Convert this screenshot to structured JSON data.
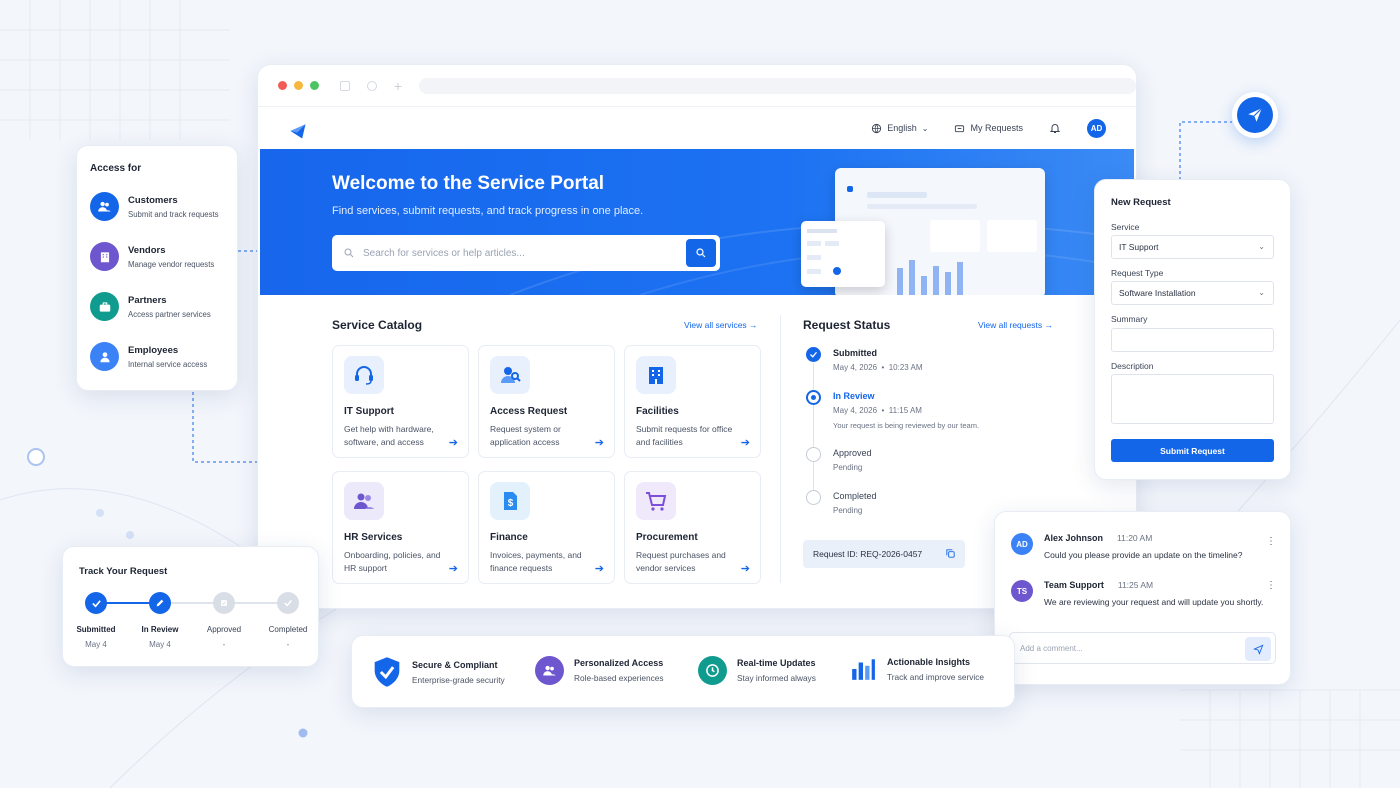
{
  "header": {
    "language": "English",
    "my_requests": "My Requests",
    "avatar_initials": "AD"
  },
  "hero": {
    "title": "Welcome to the Service Portal",
    "subtitle": "Find services, submit requests, and track progress in one place.",
    "search_placeholder": "Search for services or help articles..."
  },
  "catalog": {
    "title": "Service Catalog",
    "view_all": "View all services",
    "items": [
      {
        "title": "IT Support",
        "desc": "Get help with hardware, software, and access",
        "icon": "headset-icon"
      },
      {
        "title": "Access Request",
        "desc": "Request system or application access",
        "icon": "user-key-icon"
      },
      {
        "title": "Facilities",
        "desc": "Submit requests for office and facilities",
        "icon": "building-icon"
      },
      {
        "title": "HR Services",
        "desc": "Onboarding, policies, and HR support",
        "icon": "people-icon"
      },
      {
        "title": "Finance",
        "desc": "Invoices, payments, and finance requests",
        "icon": "dollar-doc-icon"
      },
      {
        "title": "Procurement",
        "desc": "Request purchases and vendor services",
        "icon": "cart-icon"
      }
    ]
  },
  "status": {
    "title": "Request Status",
    "view_all": "View all requests",
    "steps": [
      {
        "label": "Submitted",
        "date": "May 4, 2026",
        "time": "10:23 AM",
        "state": "done"
      },
      {
        "label": "In Review",
        "date": "May 4, 2026",
        "time": "11:15 AM",
        "note": "Your request is being reviewed by our team.",
        "state": "active"
      },
      {
        "label": "Approved",
        "sub": "Pending",
        "state": "pending"
      },
      {
        "label": "Completed",
        "sub": "Pending",
        "state": "pending"
      }
    ],
    "request_id": "Request ID: REQ-2026-0457"
  },
  "access": {
    "heading": "Access for",
    "items": [
      {
        "title": "Customers",
        "sub": "Submit and track requests",
        "color": "#1466e8"
      },
      {
        "title": "Vendors",
        "sub": "Manage vendor requests",
        "color": "#6e56cf"
      },
      {
        "title": "Partners",
        "sub": "Access partner services",
        "color": "#0f9b8e"
      },
      {
        "title": "Employees",
        "sub": "Internal service access",
        "color": "#3b82f6"
      }
    ]
  },
  "track": {
    "title": "Track Your Request",
    "steps": [
      {
        "label": "Submitted",
        "date": "May 4"
      },
      {
        "label": "In Review",
        "date": "May 4"
      },
      {
        "label": "Approved",
        "date": "-"
      },
      {
        "label": "Completed",
        "date": "-"
      }
    ]
  },
  "new_request": {
    "title": "New Request",
    "service_label": "Service",
    "service_value": "IT Support",
    "type_label": "Request Type",
    "type_value": "Software Installation",
    "summary_label": "Summary",
    "description_label": "Description",
    "submit": "Submit Request"
  },
  "chat": {
    "messages": [
      {
        "initials": "AD",
        "name": "Alex Johnson",
        "time": "11:20 AM",
        "text": "Could you please provide an update on the timeline?",
        "color": "#3b82f6"
      },
      {
        "initials": "TS",
        "name": "Team Support",
        "time": "11:25 AM",
        "text": "We are reviewing your request and will update you shortly.",
        "color": "#6e56cf"
      }
    ],
    "placeholder": "Add a comment..."
  },
  "features": [
    {
      "title": "Secure & Compliant",
      "sub": "Enterprise-grade security"
    },
    {
      "title": "Personalized Access",
      "sub": "Role-based experiences"
    },
    {
      "title": "Real-time Updates",
      "sub": "Stay informed always"
    },
    {
      "title": "Actionable Insights",
      "sub": "Track and improve service"
    }
  ],
  "colors": {
    "primary": "#1466e8",
    "text": "#1d2433",
    "muted": "#6b7384"
  }
}
